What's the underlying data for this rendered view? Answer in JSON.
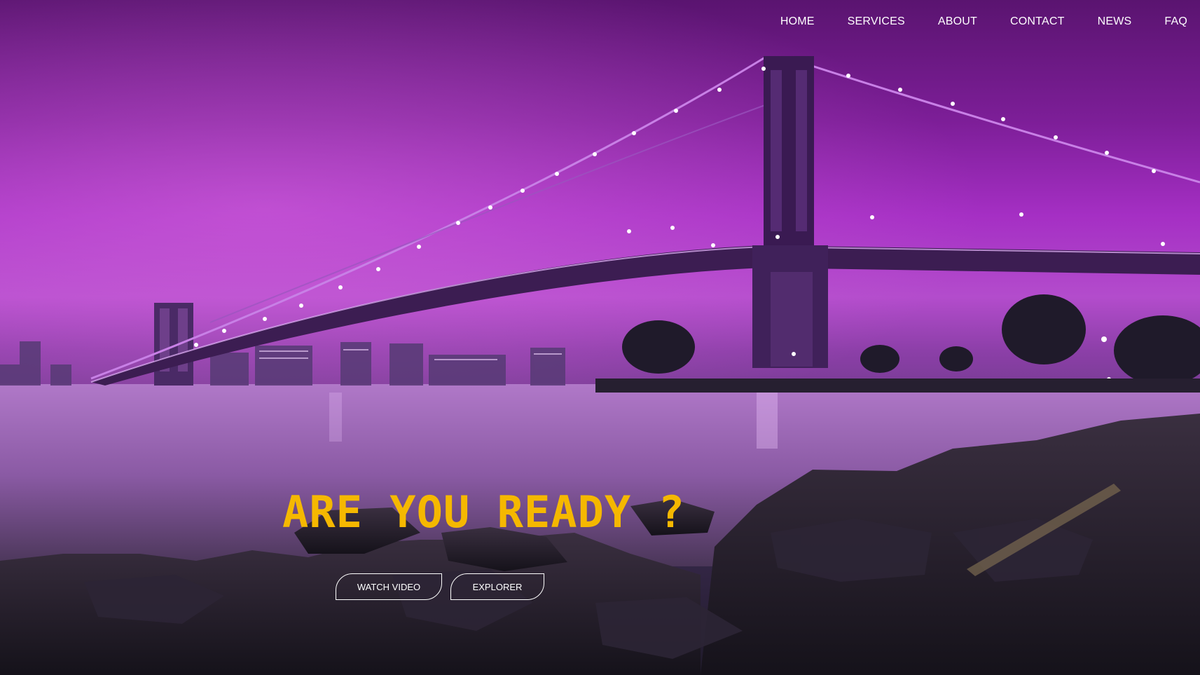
{
  "nav": {
    "items": [
      {
        "label": "HOME"
      },
      {
        "label": "SERVICES"
      },
      {
        "label": "ABOUT"
      },
      {
        "label": "CONTACT"
      },
      {
        "label": "NEWS"
      },
      {
        "label": "FAQ"
      }
    ]
  },
  "hero": {
    "headline": "ARE YOU READY ?",
    "buttons": {
      "watch_video": "WATCH VIDEO",
      "explorer": "EXPLORER"
    }
  },
  "colors": {
    "headline": "#f5b800",
    "nav_text": "#ffffff",
    "sky_top": "#5a1470",
    "sky_glow": "#b34ccc"
  }
}
